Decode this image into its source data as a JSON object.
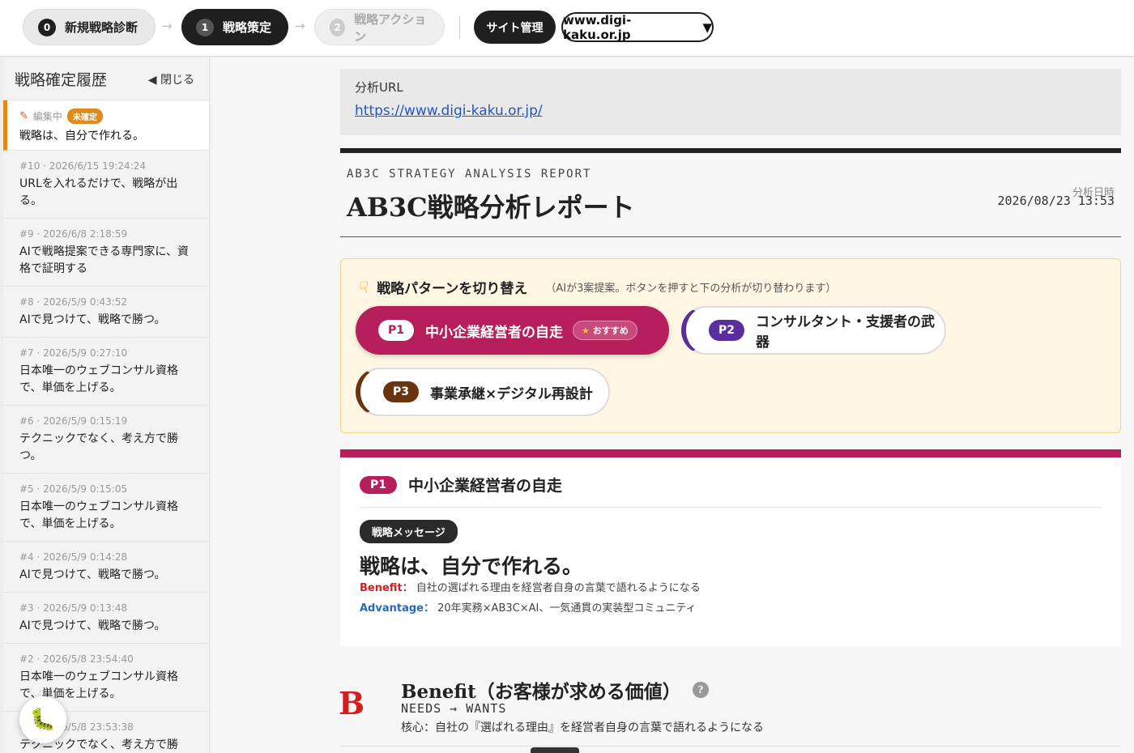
{
  "steps": [
    {
      "num": "0",
      "label": "新規戦略診断"
    },
    {
      "num": "1",
      "label": "戦略策定"
    },
    {
      "num": "2",
      "label": "戦略アクション"
    }
  ],
  "arrows": [
    "→",
    "→"
  ],
  "site_button": "サイト管理",
  "domain_select": {
    "value": "www.digi-kaku.or.jp",
    "caret": "▼"
  },
  "sidebar": {
    "title": "戦略確定履歴",
    "close_label": "◀ 閉じる",
    "current": {
      "status": "編集中",
      "badge": "未確定",
      "text": "戦略は、自分で作れる。"
    },
    "items": [
      {
        "meta": "#10 · 2026/6/15 19:24:24",
        "text": "URLを入れるだけで、戦略が出る。"
      },
      {
        "meta": "#9 · 2026/6/8 2:18:59",
        "text": "AIで戦略提案できる専門家に、資格で証明する"
      },
      {
        "meta": "#8 · 2026/5/9 0:43:52",
        "text": "AIで見つけて、戦略で勝つ。"
      },
      {
        "meta": "#7 · 2026/5/9 0:27:10",
        "text": "日本唯一のウェブコンサル資格で、単価を上げる。"
      },
      {
        "meta": "#6 · 2026/5/9 0:15:19",
        "text": "テクニックでなく、考え方で勝つ。"
      },
      {
        "meta": "#5 · 2026/5/9 0:15:05",
        "text": "日本唯一のウェブコンサル資格で、単価を上げる。"
      },
      {
        "meta": "#4 · 2026/5/9 0:14:28",
        "text": "AIで見つけて、戦略で勝つ。"
      },
      {
        "meta": "#3 · 2026/5/9 0:13:48",
        "text": "AIで見つけて、戦略で勝つ。"
      },
      {
        "meta": "#2 · 2026/5/8 23:54:40",
        "text": "日本唯一のウェブコンサル資格で、単価を上げる。"
      },
      {
        "meta": "#1 · 2026/5/8 23:53:38",
        "text": "テクニックでなく、考え方で勝つ。"
      }
    ]
  },
  "analysis": {
    "url_label": "分析URL",
    "url": "https://www.digi-kaku.or.jp/"
  },
  "report": {
    "subtitle": "AB3C STRATEGY ANALYSIS REPORT",
    "title": "AB3C戦略分析レポート",
    "date_label": "分析日時",
    "date_value": "2026/08/23 13:53"
  },
  "pattern_switch": {
    "title": "戦略パターンを切り替え",
    "note": "（AIが3案提案。ボタンを押すと下の分析が切り替わります）",
    "patterns": [
      {
        "tag": "P1",
        "label": "中小企業経営者の自走",
        "recommend": "おすすめ"
      },
      {
        "tag": "P2",
        "label": "コンサルタント・支援者の武器"
      },
      {
        "tag": "P3",
        "label": "事業承継×デジタル再設計"
      }
    ]
  },
  "message_card": {
    "tag": "P1",
    "title": "中小企業経営者の自走",
    "pill": "戦略メッセージ",
    "message": "戦略は、自分で作れる。",
    "benefit_label": "Benefit：",
    "benefit_text": "自社の選ばれる理由を経営者自身の言葉で語れるようになる",
    "advantage_label": "Advantage：",
    "advantage_text": "20年実務×AB3C×AI、一気通貫の実装型コミュニティ"
  },
  "benefit_section": {
    "letter": "B",
    "title": "Benefit（お客様が求める価値）",
    "help": "?",
    "needs": "NEEDS → WANTS",
    "core": "核心：自社の『選ばれる理由』を経営者自身の言葉で語れるようになる"
  },
  "colors": {
    "p1": "#b71e5c",
    "p2": "#5a2e9e",
    "p3": "#6b3410",
    "accent_orange": "#e08a1e",
    "benefit_red": "#d81b1b"
  }
}
